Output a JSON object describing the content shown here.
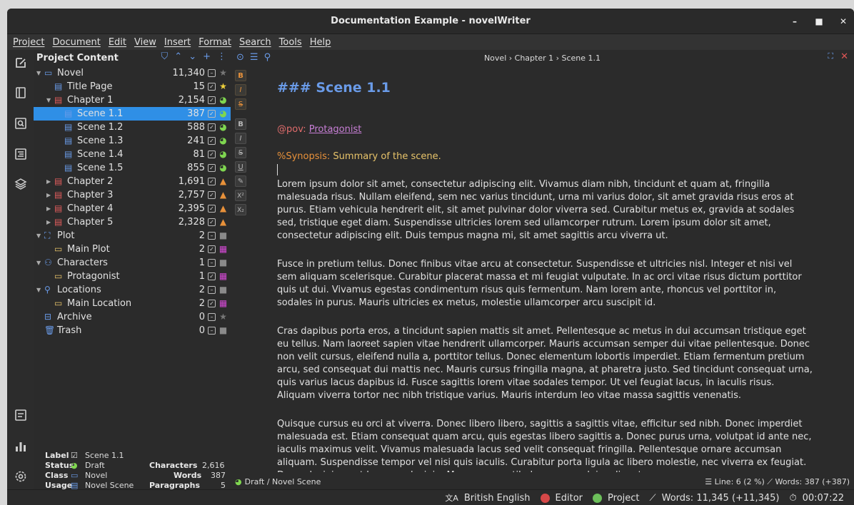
{
  "window": {
    "title": "Documentation Example - novelWriter"
  },
  "menu": [
    "Project",
    "Document",
    "Edit",
    "View",
    "Insert",
    "Format",
    "Search",
    "Tools",
    "Help"
  ],
  "tree": {
    "header": "Project Content",
    "rows": [
      {
        "label": "Novel",
        "count": "11,340",
        "status": "none-star",
        "level": 0,
        "arrow": "down",
        "icon": "novel-root-icon"
      },
      {
        "label": "Title Page",
        "count": "15",
        "status": "star-yellow",
        "level": 1,
        "arrow": "",
        "icon": "document-icon"
      },
      {
        "label": "Chapter 1",
        "count": "2,154",
        "status": "moon-green",
        "level": 1,
        "arrow": "down",
        "icon": "chapter-icon"
      },
      {
        "label": "Scene 1.1",
        "count": "387",
        "status": "moon-green",
        "level": 2,
        "arrow": "",
        "icon": "document-icon"
      },
      {
        "label": "Scene 1.2",
        "count": "588",
        "status": "moon-green",
        "level": 2,
        "arrow": "",
        "icon": "document-icon"
      },
      {
        "label": "Scene 1.3",
        "count": "241",
        "status": "moon-green",
        "level": 2,
        "arrow": "",
        "icon": "document-icon"
      },
      {
        "label": "Scene 1.4",
        "count": "81",
        "status": "moon-green",
        "level": 2,
        "arrow": "",
        "icon": "document-icon"
      },
      {
        "label": "Scene 1.5",
        "count": "855",
        "status": "moon-green",
        "level": 2,
        "arrow": "",
        "icon": "document-icon"
      },
      {
        "label": "Chapter 2",
        "count": "1,691",
        "status": "triangle-orange",
        "level": 1,
        "arrow": "right",
        "icon": "chapter-icon"
      },
      {
        "label": "Chapter 3",
        "count": "2,757",
        "status": "triangle-orange",
        "level": 1,
        "arrow": "right",
        "icon": "chapter-icon"
      },
      {
        "label": "Chapter 4",
        "count": "2,395",
        "status": "triangle-orange",
        "level": 1,
        "arrow": "right",
        "icon": "chapter-icon"
      },
      {
        "label": "Chapter 5",
        "count": "2,328",
        "status": "triangle-orange",
        "level": 1,
        "arrow": "right",
        "icon": "chapter-icon"
      },
      {
        "label": "Plot",
        "count": "2",
        "status": "square-grey",
        "level": 0,
        "arrow": "down",
        "icon": "plot-root-icon"
      },
      {
        "label": "Main Plot",
        "count": "2",
        "status": "grid-magenta",
        "level": 1,
        "arrow": "",
        "icon": "note-icon"
      },
      {
        "label": "Characters",
        "count": "1",
        "status": "square-grey",
        "level": 0,
        "arrow": "down",
        "icon": "characters-root-icon"
      },
      {
        "label": "Protagonist",
        "count": "1",
        "status": "grid-magenta",
        "level": 1,
        "arrow": "",
        "icon": "note-icon"
      },
      {
        "label": "Locations",
        "count": "2",
        "status": "square-grey",
        "level": 0,
        "arrow": "down",
        "icon": "locations-root-icon"
      },
      {
        "label": "Main Location",
        "count": "2",
        "status": "grid-magenta",
        "level": 1,
        "arrow": "",
        "icon": "note-icon"
      },
      {
        "label": "Archive",
        "count": "0",
        "status": "none-star",
        "level": 0,
        "arrow": "",
        "icon": "archive-icon"
      },
      {
        "label": "Trash",
        "count": "0",
        "status": "square-grey",
        "level": 0,
        "arrow": "",
        "icon": "trash-icon"
      }
    ]
  },
  "details": {
    "label_key": "Label",
    "label_val": "Scene 1.1",
    "status_key": "Status",
    "status_val": "Draft",
    "class_key": "Class",
    "class_val": "Novel",
    "usage_key": "Usage",
    "usage_val": "Novel Scene",
    "chars_key": "Characters",
    "chars_val": "2,616",
    "words_key": "Words",
    "words_val": "387",
    "paras_key": "Paragraphs",
    "paras_val": "5"
  },
  "editor": {
    "breadcrumb": "Novel › Chapter 1 › Scene 1.1",
    "heading": "### Scene 1.1",
    "pov_key": "@pov:",
    "pov_val": "Protagonist",
    "synopsis_key": "%Synopsis:",
    "synopsis_val": "Summary of the scene.",
    "paragraphs": [
      "Lorem ipsum dolor sit amet, consectetur adipiscing elit. Vivamus diam nibh, tincidunt et quam at, fringilla malesuada risus. Nullam eleifend, sem nec varius tincidunt, urna mi varius dolor, sit amet gravida risus eros at purus. Etiam vehicula hendrerit elit, sit amet pulvinar dolor viverra sed. Curabitur metus ex, gravida at sodales sed, tristique eget diam. Suspendisse ultricies lorem sed ullamcorper rutrum. Lorem ipsum dolor sit amet, consectetur adipiscing elit. Duis tempus magna mi, sit amet sagittis arcu viverra ut.",
      "Fusce in pretium tellus. Donec finibus vitae arcu at consectetur. Suspendisse et ultricies nisl. Integer et nisi vel sem aliquam scelerisque. Curabitur placerat massa et mi feugiat vulputate. In ac orci vitae risus dictum porttitor quis ut dui. Vivamus egestas condimentum risus quis fermentum. Nam lorem ante, rhoncus vel porttitor in, sodales in purus. Mauris ultricies ex metus, molestie ullamcorper arcu suscipit id.",
      "Cras dapibus porta eros, a tincidunt sapien mattis sit amet. Pellentesque ac metus in dui accumsan tristique eget eu tellus. Nam laoreet sapien vitae hendrerit ullamcorper. Mauris accumsan semper dui vitae pellentesque. Donec non velit cursus, eleifend nulla a, porttitor tellus. Donec elementum lobortis imperdiet. Etiam fermentum pretium arcu, sed consequat dui mattis nec. Mauris cursus fringilla magna, at pharetra justo. Sed tincidunt consequat urna, quis varius lacus dapibus id. Fusce sagittis lorem vitae sodales tempor. Ut vel feugiat lacus, in iaculis risus. Aliquam viverra tortor nec nibh tristique varius. Mauris interdum leo vitae massa sagittis venenatis.",
      "Quisque cursus eu orci at viverra. Donec libero libero, sagittis a sagittis vitae, efficitur sed nibh. Donec imperdiet malesuada est. Etiam consequat quam arcu, quis egestas libero sagittis a. Donec purus urna, volutpat id ante nec, iaculis maximus velit. Vivamus malesuada lacus sed velit consequat fringilla. Pellentesque ornare accumsan aliquam. Suspendisse tempor vel nisi quis iaculis. Curabitur porta ligula ac libero molestie, nec viverra ex feugiat. Donec lacinia eget lorem eu lacinia. Maecenas vestibulum ornare dui a aliquet."
    ],
    "status_left": "Draft / Novel Scene",
    "status_right": "☰ Line: 6 (2 %)  ⟋ Words: 387 (+387)"
  },
  "format_buttons": [
    "B",
    "I",
    "S",
    "B",
    "I",
    "S",
    "U",
    "✎",
    "X²",
    "X₂"
  ],
  "statusbar": {
    "language": "British English",
    "editor": "Editor",
    "project": "Project",
    "words": "Words: 11,345 (+11,345)",
    "time": "00:07:22"
  },
  "colors": {
    "accent": "#2f8fe6",
    "heading": "#6a9be8",
    "pov_key": "#e06c6c",
    "pov_val": "#c87fd6",
    "synopsis_key": "#e8913a",
    "synopsis_val": "#e8c46a"
  }
}
